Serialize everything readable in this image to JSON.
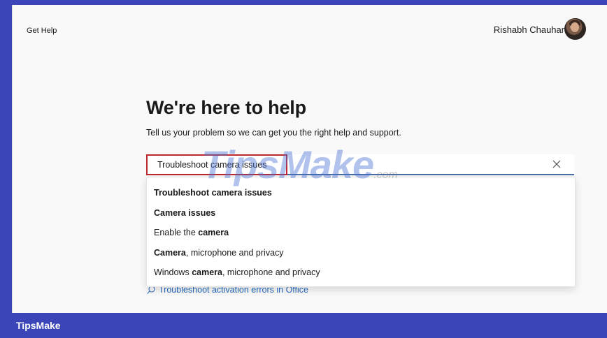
{
  "app": {
    "title": "Get Help",
    "user_name": "Rishabh Chauhan"
  },
  "main": {
    "heading": "We're here to help",
    "subheading": "Tell us your problem so we can get you the right help and support.",
    "search": {
      "value": "Troubleshoot camera issues"
    },
    "suggestions": [
      {
        "parts": [
          {
            "text": "Troubleshoot camera issues",
            "bold": true
          }
        ]
      },
      {
        "parts": [
          {
            "text": "Camera issues",
            "bold": true
          }
        ]
      },
      {
        "parts": [
          {
            "text": "Enable the ",
            "bold": false
          },
          {
            "text": "camera",
            "bold": true
          }
        ]
      },
      {
        "parts": [
          {
            "text": "Camera",
            "bold": true
          },
          {
            "text": ", microphone and privacy",
            "bold": false
          }
        ]
      },
      {
        "parts": [
          {
            "text": "Windows ",
            "bold": false
          },
          {
            "text": "camera",
            "bold": true
          },
          {
            "text": ", microphone and privacy",
            "bold": false
          }
        ]
      }
    ],
    "behind_link": "Troubleshoot activation errors in Office"
  },
  "watermark": {
    "main": "TipsMake",
    "suffix": ".com"
  },
  "footer": {
    "brand": "TipsMake"
  },
  "colors": {
    "frame_background": "#3b45b8",
    "window_background": "#f9f9f9",
    "search_underline": "#4a6fa5",
    "highlight_border": "#c0282c",
    "link": "#2a6cc0"
  }
}
